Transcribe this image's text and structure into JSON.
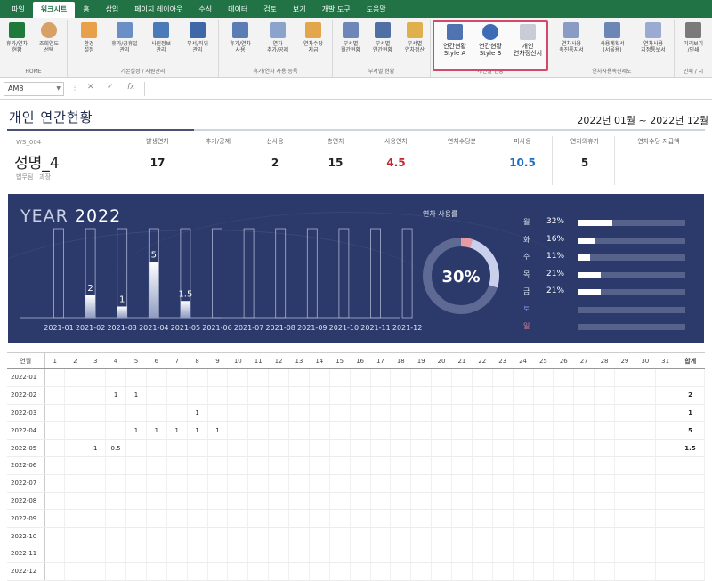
{
  "ribbon": {
    "tabs": [
      "파일",
      "워크시트",
      "홈",
      "삽입",
      "페이지 레이아웃",
      "수식",
      "데이터",
      "검토",
      "보기",
      "개발 도구",
      "도움말"
    ],
    "active_tab": "워크시트",
    "groups": {
      "home": {
        "label": "HOME",
        "buttons": [
          "휴가/연차\n현황",
          "조회연도\n선택"
        ]
      },
      "basic": {
        "label": "기본설정 / 사원관리",
        "buttons": [
          "환경\n설정",
          "휴가/공휴일\n관리",
          "사원정보\n관리",
          "부서/직위\n관리"
        ]
      },
      "register": {
        "label": "휴가/연차 사용 등록",
        "buttons": [
          "휴가/연차\n사용",
          "연차\n추가/공제",
          "연차수당\n지급"
        ]
      },
      "dept": {
        "label": "부서별 현황",
        "buttons": [
          "부서별\n월간현황",
          "부서별\n연간현황",
          "부서별\n연차정산"
        ]
      },
      "personal": {
        "label": "개인별 현황",
        "buttons": [
          "연간현황\nStyle A",
          "연간현황\nStyle B",
          "개인\n연차정산서"
        ]
      },
      "promo": {
        "label": "연차사용촉진제도",
        "buttons": [
          "연차사용\n촉진통지서",
          "사용계획서\n(서울용)",
          "연차사용\n지정통보서"
        ]
      },
      "print": {
        "label": "인쇄 / 시",
        "buttons": [
          "미리보기\n/인쇄"
        ]
      }
    }
  },
  "formula_bar": {
    "name_box": "AM8",
    "cancel": "✕",
    "confirm": "✓",
    "fx": "fx",
    "formula": ""
  },
  "sheet": {
    "title": "개인 연간현황",
    "date_range": "2022년 01월 ~ 2022년 12월",
    "person": {
      "id": "WS_004",
      "name": "성명_4",
      "dept": "법무팀 | 과장"
    },
    "stats": [
      {
        "label": "발생연차",
        "value": "17",
        "color": "#222222"
      },
      {
        "label": "추가/공제",
        "value": "",
        "color": "#222222"
      },
      {
        "label": "선사용",
        "value": "2",
        "color": "#222222"
      },
      {
        "label": "총연차",
        "value": "15",
        "color": "#222222"
      },
      {
        "label": "사용연차",
        "value": "4.5",
        "color": "#c0262d"
      },
      {
        "label": "연차수당분",
        "value": "",
        "color": "#222222"
      },
      {
        "label": "미사용",
        "value": "10.5",
        "color": "#1b6fc2"
      },
      {
        "label": "연차외휴가",
        "value": "5",
        "color": "#222222"
      },
      {
        "label": "연차수당 지급액",
        "value": "",
        "color": "#222222"
      }
    ],
    "dashboard": {
      "year_prefix": "YEAR",
      "year": "2022",
      "donut_title": "연차 사용률",
      "donut_value": "30%",
      "donut_fraction": 0.3,
      "weekdays": [
        {
          "day": "월",
          "pct": "32%",
          "fraction": 0.32,
          "color": "#dfe4f2"
        },
        {
          "day": "화",
          "pct": "16%",
          "fraction": 0.16,
          "color": "#dfe4f2"
        },
        {
          "day": "수",
          "pct": "11%",
          "fraction": 0.11,
          "color": "#dfe4f2"
        },
        {
          "day": "목",
          "pct": "21%",
          "fraction": 0.21,
          "color": "#dfe4f2"
        },
        {
          "day": "금",
          "pct": "21%",
          "fraction": 0.21,
          "color": "#dfe4f2"
        },
        {
          "day": "토",
          "pct": "",
          "fraction": 0,
          "color": "#7f92e0"
        },
        {
          "day": "일",
          "pct": "",
          "fraction": 0,
          "color": "#e07f8f"
        }
      ]
    },
    "grid": {
      "month_header": "연월",
      "total_header": "합계",
      "days": [
        "1",
        "2",
        "3",
        "4",
        "5",
        "6",
        "7",
        "8",
        "9",
        "10",
        "11",
        "12",
        "13",
        "14",
        "15",
        "16",
        "17",
        "18",
        "19",
        "20",
        "21",
        "22",
        "23",
        "24",
        "25",
        "26",
        "27",
        "28",
        "29",
        "30",
        "31"
      ],
      "rows": [
        {
          "month": "2022-01",
          "cells": {},
          "total": ""
        },
        {
          "month": "2022-02",
          "cells": {
            "4": "1",
            "5": "1"
          },
          "total": "2"
        },
        {
          "month": "2022-03",
          "cells": {
            "8": "1"
          },
          "total": "1"
        },
        {
          "month": "2022-04",
          "cells": {
            "5": "1",
            "6": "1",
            "7": "1",
            "8": "1",
            "9": "1"
          },
          "total": "5"
        },
        {
          "month": "2022-05",
          "cells": {
            "3": "1",
            "4": "0.5"
          },
          "total": "1.5"
        },
        {
          "month": "2022-06",
          "cells": {},
          "total": ""
        },
        {
          "month": "2022-07",
          "cells": {},
          "total": ""
        },
        {
          "month": "2022-08",
          "cells": {},
          "total": ""
        },
        {
          "month": "2022-09",
          "cells": {},
          "total": ""
        },
        {
          "month": "2022-10",
          "cells": {},
          "total": ""
        },
        {
          "month": "2022-11",
          "cells": {},
          "total": ""
        },
        {
          "month": "2022-12",
          "cells": {},
          "total": ""
        }
      ]
    }
  },
  "chart_data": {
    "type": "bar",
    "categories": [
      "2021-01",
      "2021-02",
      "2021-03",
      "2021-04",
      "2021-05",
      "2021-06",
      "2021-07",
      "2021-08",
      "2021-09",
      "2021-10",
      "2021-11",
      "2021-12"
    ],
    "values": [
      0,
      2,
      1,
      5,
      1.5,
      0,
      0,
      0,
      0,
      0,
      0,
      0
    ],
    "value_labels": [
      "",
      "2",
      "1",
      "5",
      "1.5",
      "",
      "",
      "",
      "",
      "",
      "",
      ""
    ],
    "ylim": [
      0,
      8
    ],
    "title": "",
    "xlabel": "",
    "ylabel": ""
  }
}
